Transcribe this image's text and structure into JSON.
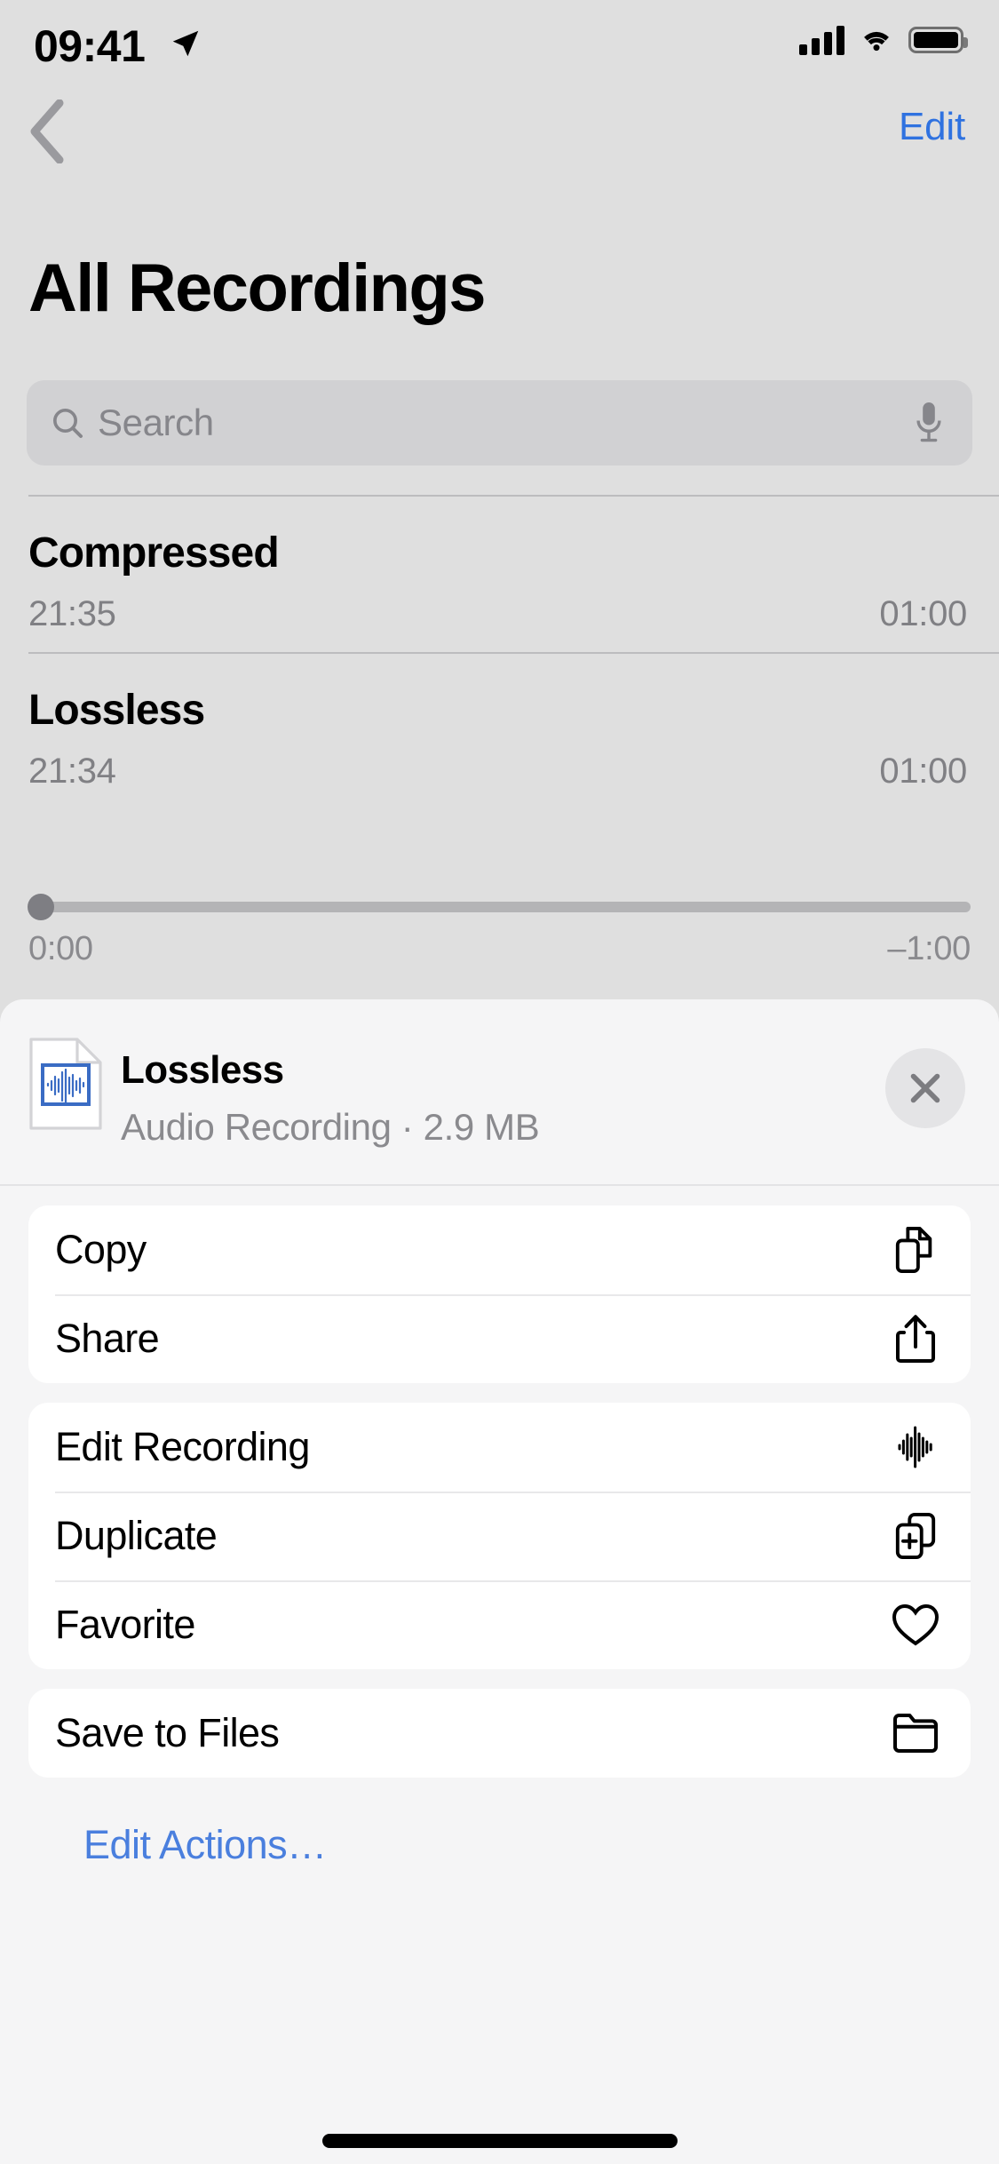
{
  "status_bar": {
    "time": "09:41",
    "location_icon": "location-arrow-icon",
    "signal_icon": "cellular-signal-icon",
    "wifi_icon": "wifi-icon",
    "battery_icon": "battery-full-icon"
  },
  "nav": {
    "back_icon": "chevron-left-icon",
    "edit_label": "Edit"
  },
  "header": {
    "title": "All Recordings"
  },
  "search": {
    "placeholder": "Search",
    "value": "",
    "search_icon": "search-icon",
    "mic_icon": "microphone-icon"
  },
  "recordings": [
    {
      "name": "Compressed",
      "time": "21:35",
      "duration": "01:00"
    },
    {
      "name": "Lossless",
      "time": "21:34",
      "duration": "01:00"
    }
  ],
  "player": {
    "current_time": "0:00",
    "remaining_time": "–1:00",
    "progress_percent": 0
  },
  "share_sheet": {
    "file_icon": "audio-document-icon",
    "file_name": "Lossless",
    "file_meta": "Audio Recording · 2.9 MB",
    "close_icon": "close-icon",
    "edit_actions_label": "Edit Actions…",
    "groups": [
      {
        "items": [
          {
            "label": "Copy",
            "icon": "copy-icon"
          },
          {
            "label": "Share",
            "icon": "share-icon"
          }
        ]
      },
      {
        "items": [
          {
            "label": "Edit Recording",
            "icon": "waveform-icon"
          },
          {
            "label": "Duplicate",
            "icon": "duplicate-icon"
          },
          {
            "label": "Favorite",
            "icon": "heart-icon"
          }
        ]
      },
      {
        "items": [
          {
            "label": "Save to Files",
            "icon": "folder-icon"
          }
        ]
      }
    ]
  },
  "colors": {
    "accent_blue": "#2f72e0",
    "link_blue": "#4a7fde",
    "screen_bg": "#dfdfdf",
    "sheet_bg": "#f5f5f6",
    "card_bg": "#ffffff",
    "secondary_text": "#8a8a8e"
  }
}
